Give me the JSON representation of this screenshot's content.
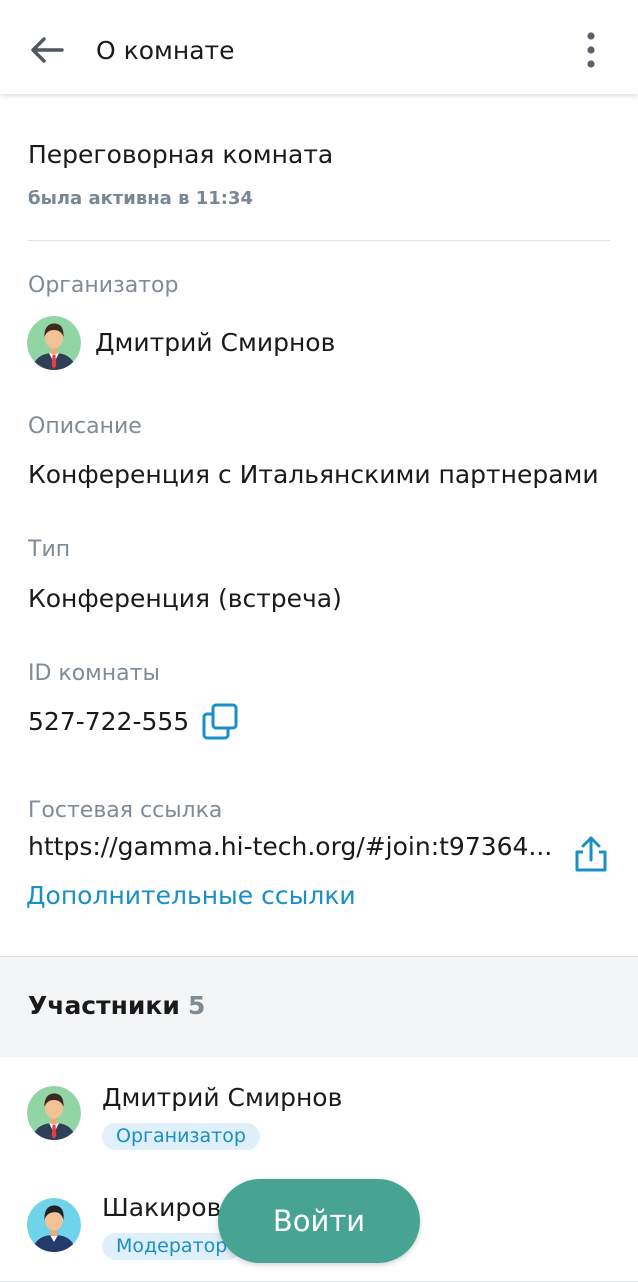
{
  "header": {
    "title": "О комнате",
    "back_icon": "arrow-left-icon",
    "menu_icon": "more-vertical-icon"
  },
  "room": {
    "name": "Переговорная комната",
    "activity": "была активна в 11:34"
  },
  "organizer": {
    "label": "Организатор",
    "name": "Дмитрий Смирнов"
  },
  "description": {
    "label": "Описание",
    "value": "Конференция с Итальянскими партнерами"
  },
  "type": {
    "label": "Тип",
    "value": "Конференция (встреча)"
  },
  "room_id": {
    "label": "ID комнаты",
    "value": "527-722-555",
    "copy_icon": "copy-icon"
  },
  "guest_link": {
    "label": "Гостевая ссылка",
    "value": "https://gamma.hi-tech.org/#join:t97364...",
    "share_icon": "share-icon",
    "extra_links": "Дополнительные ссылки"
  },
  "participants": {
    "title": "Участники",
    "count": "5",
    "items": [
      {
        "name": "Дмитрий Смирнов",
        "role": "Организатор"
      },
      {
        "name": "Шакиров",
        "role": "Модератор"
      }
    ]
  },
  "join_button": {
    "label": "Войти"
  },
  "colors": {
    "accent": "#1a8ec6",
    "join_button": "#47a493",
    "badge_bg": "#dff0fa",
    "muted_text": "#7f8b96"
  }
}
